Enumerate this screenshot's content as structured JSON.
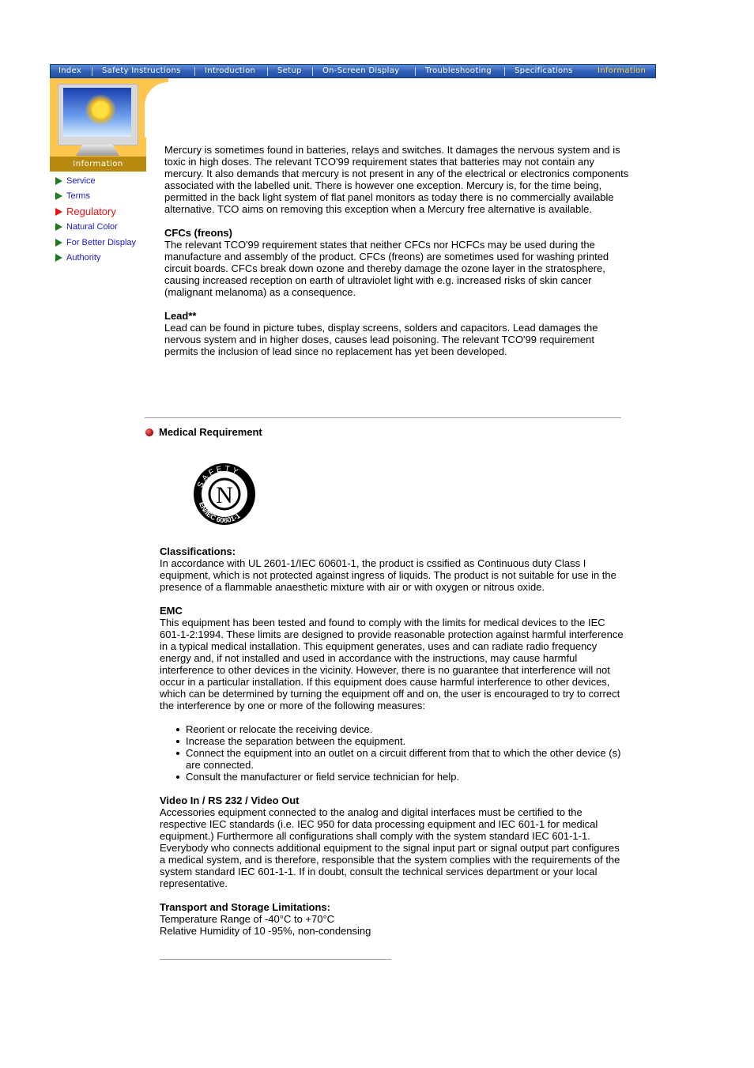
{
  "nav": {
    "items": [
      {
        "label": "Index"
      },
      {
        "label": "Safety Instructions"
      },
      {
        "label": "Introduction"
      },
      {
        "label": "Setup"
      },
      {
        "label": "On-Screen Display"
      },
      {
        "label": "Troubleshooting"
      },
      {
        "label": "Specifications"
      },
      {
        "label": "Information",
        "active": true
      }
    ],
    "active_color": "#ffcc33"
  },
  "sidebar": {
    "section_label": "Information",
    "items": [
      {
        "label": "Service"
      },
      {
        "label": "Terms"
      },
      {
        "label": "Regulatory",
        "active": true
      },
      {
        "label": "Natural Color"
      },
      {
        "label": "For Better Display"
      },
      {
        "label": "Authority"
      }
    ]
  },
  "content": {
    "mercury": "Mercury is sometimes found in batteries, relays and switches. It damages the nervous system and is toxic in high doses. The relevant TCO'99 requirement states that batteries may not contain any mercury. It also demands that mercury is not present in any of the electrical or electronics components associated with the labelled unit. There is however one exception. Mercury is, for the time being, permitted in the back light system of flat panel monitors as today there is no commercially available alternative. TCO aims on removing this exception when a Mercury free alternative is available.",
    "cfcs_title": "CFCs (freons)",
    "cfcs": "The relevant TCO'99 requirement states that neither CFCs nor HCFCs may be used during the manufacture and assembly of the product. CFCs (freons) are sometimes used for washing printed circuit boards. CFCs break down ozone and thereby damage the ozone layer in the stratosphere, causing increased reception on earth of ultraviolet light with e.g. increased risks of skin cancer (malignant melanoma) as a consequence.",
    "lead_title": "Lead**",
    "lead": "Lead can be found in picture tubes, display screens, solders and capacitors. Lead damages the nervous system and in higher doses, causes lead poisoning. The relevant TCO'99 requirement permits the inclusion of lead since no replacement has yet been developed."
  },
  "medical": {
    "heading": "Medical Requirement",
    "logo": {
      "ring_text": "SAFETY",
      "center": "N",
      "bottom_text": "EN/IEC 60601-1"
    },
    "classifications_title": "Classifications:",
    "classifications": "In accordance with UL 2601-1/IEC 60601-1, the product is cssified as Continuous duty Class I equipment, which is not protected against ingress of liquids. The product is not suitable for use in the presence of a flammable anaesthetic mixture with air or with oxygen or nitrous oxide.",
    "emc_title": "EMC",
    "emc": "This equipment has been tested and found to comply with the limits for medical devices to the IEC 601-1-2:1994. These limits are designed to provide reasonable protection against harmful interference in a typical medical installation. This equipment generates, uses and can radiate radio frequency energy and, if not installed and used in accordance with the instructions, may cause harmful interference to other devices in the vicinity. However, there is no guarantee that interference will not occur in a particular installation. If this equipment does cause harmful interference to other devices, which can be determined by turning the equipment off and on, the user is encouraged to try to correct the interference by one or more of the following measures:",
    "measures": [
      "Reorient or relocate the receiving device.",
      "Increase the separation between the equipment.",
      "Connect the equipment into an outlet on a circuit different from that to which the other device (s) are connected.",
      "Consult the manufacturer or field service technician for help."
    ],
    "video_title": "Video In / RS 232 / Video Out",
    "video": "Accessories equipment connected to the analog and digital interfaces must be certified to the respective IEC standards (i.e. IEC 950 for data processing equipment and IEC 601-1 for medical equipment.) Furthermore all configurations shall comply with the system standard IEC 601-1-1. Everybody who connects additional equipment to the signal input part or signal output part configures a medical system, and is therefore, responsible that the system complies with the requirements of the system standard IEC 601-1-1. If in doubt, consult the technical services department or your local representative.",
    "transport_title": "Transport and Storage Limitations:",
    "temperature": "Temperature Range of -40°C to +70°C",
    "humidity": "Relative Humidity of 10 -95%, non-condensing"
  }
}
